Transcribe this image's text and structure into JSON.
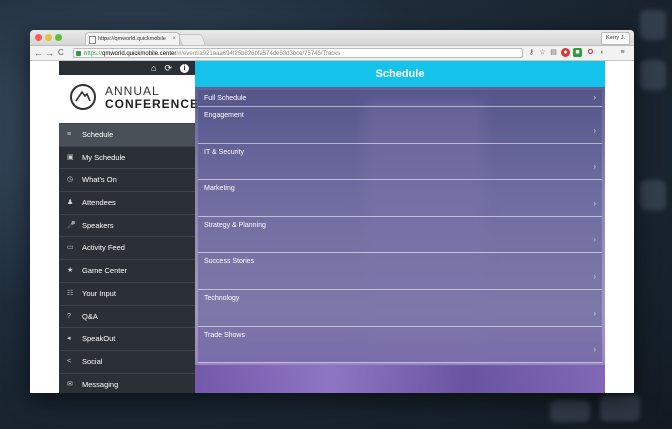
{
  "browser": {
    "tab_title": "https://qmworld.quickmobile",
    "tab_close": "×",
    "user_label": "Kerry J.",
    "url": {
      "scheme": "https://",
      "domain": "qmworld.quickmobile.center",
      "path": "/#/event/a921aaa694f25b826bfa574de53d3bce/75745/Tracks"
    },
    "back": "←",
    "forward": "→",
    "reload": "C"
  },
  "top_icons": {
    "home": "⌂",
    "refresh": "⟳",
    "info": "i"
  },
  "logo": {
    "line1": "ANNUAL",
    "line2": "CONFERENCE"
  },
  "menu": [
    {
      "label": "Schedule",
      "icon": "≡",
      "active": true
    },
    {
      "label": "My Schedule",
      "icon": "▣"
    },
    {
      "label": "What's On",
      "icon": "◷"
    },
    {
      "label": "Attendees",
      "icon": "♟"
    },
    {
      "label": "Speakers",
      "icon": "🎤"
    },
    {
      "label": "Activity Feed",
      "icon": "▭"
    },
    {
      "label": "Game Center",
      "icon": "★"
    },
    {
      "label": "Your Input",
      "icon": "☷"
    },
    {
      "label": "Q&A",
      "icon": "?"
    },
    {
      "label": "SpeakOut",
      "icon": "◂"
    },
    {
      "label": "Social",
      "icon": "<"
    },
    {
      "label": "Messaging",
      "icon": "✉"
    }
  ],
  "schedule": {
    "title": "Schedule",
    "tracks": [
      "Full Schedule",
      "Engagement",
      "IT & Security",
      "Marketing",
      "Strategy & Planning",
      "Success Stories",
      "Technology",
      "Trade Shows"
    ]
  },
  "colors": {
    "accent": "#15c2ea",
    "sidebar": "#2b3036"
  }
}
